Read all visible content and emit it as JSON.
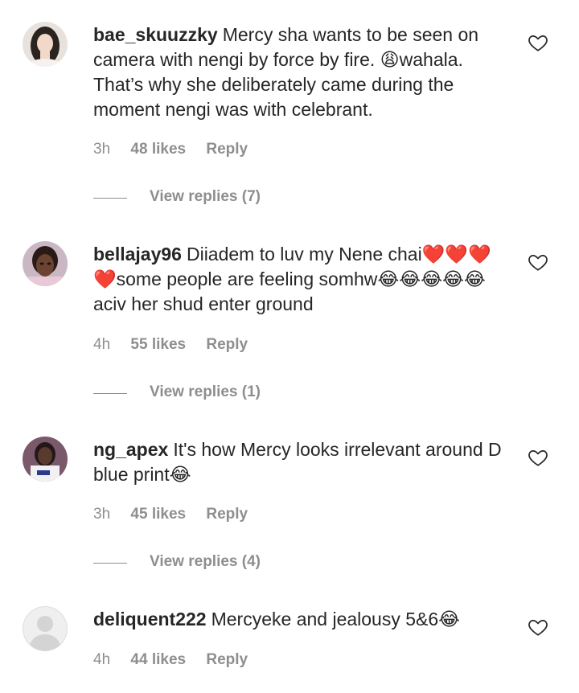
{
  "comments": [
    {
      "username": "bae_skuuzzky",
      "text": "Mercy sha wants to be seen on camera with nengi by force by fire. 😩wahala. That’s why she deliberately came during the moment nengi was with celebrant.",
      "time": "3h",
      "likes": "48 likes",
      "reply": "Reply",
      "view_replies": "View replies (7)",
      "avatar": "woman-portrait-avatar"
    },
    {
      "username": "bellajay96",
      "text": "Diiadem to luv my Nene chai❤️❤️❤️❤️some people are feeling somhw😂😂😂😂😂aciv her shud enter ground",
      "time": "4h",
      "likes": "55 likes",
      "reply": "Reply",
      "view_replies": "View replies (1)",
      "avatar": "selfie-avatar"
    },
    {
      "username": "ng_apex",
      "text": "It's how Mercy looks irrelevant around D blue print😂",
      "time": "3h",
      "likes": "45 likes",
      "reply": "Reply",
      "view_replies": "View replies (4)",
      "avatar": "person-shirt-avatar"
    },
    {
      "username": "deliquent222",
      "text": "Mercyeke and jealousy 5&6😂",
      "time": "4h",
      "likes": "44 likes",
      "reply": "Reply",
      "avatar": "default-user-avatar"
    }
  ],
  "colors": {
    "text": "#262626",
    "secondary": "#8e8e8e",
    "background": "#ffffff"
  }
}
